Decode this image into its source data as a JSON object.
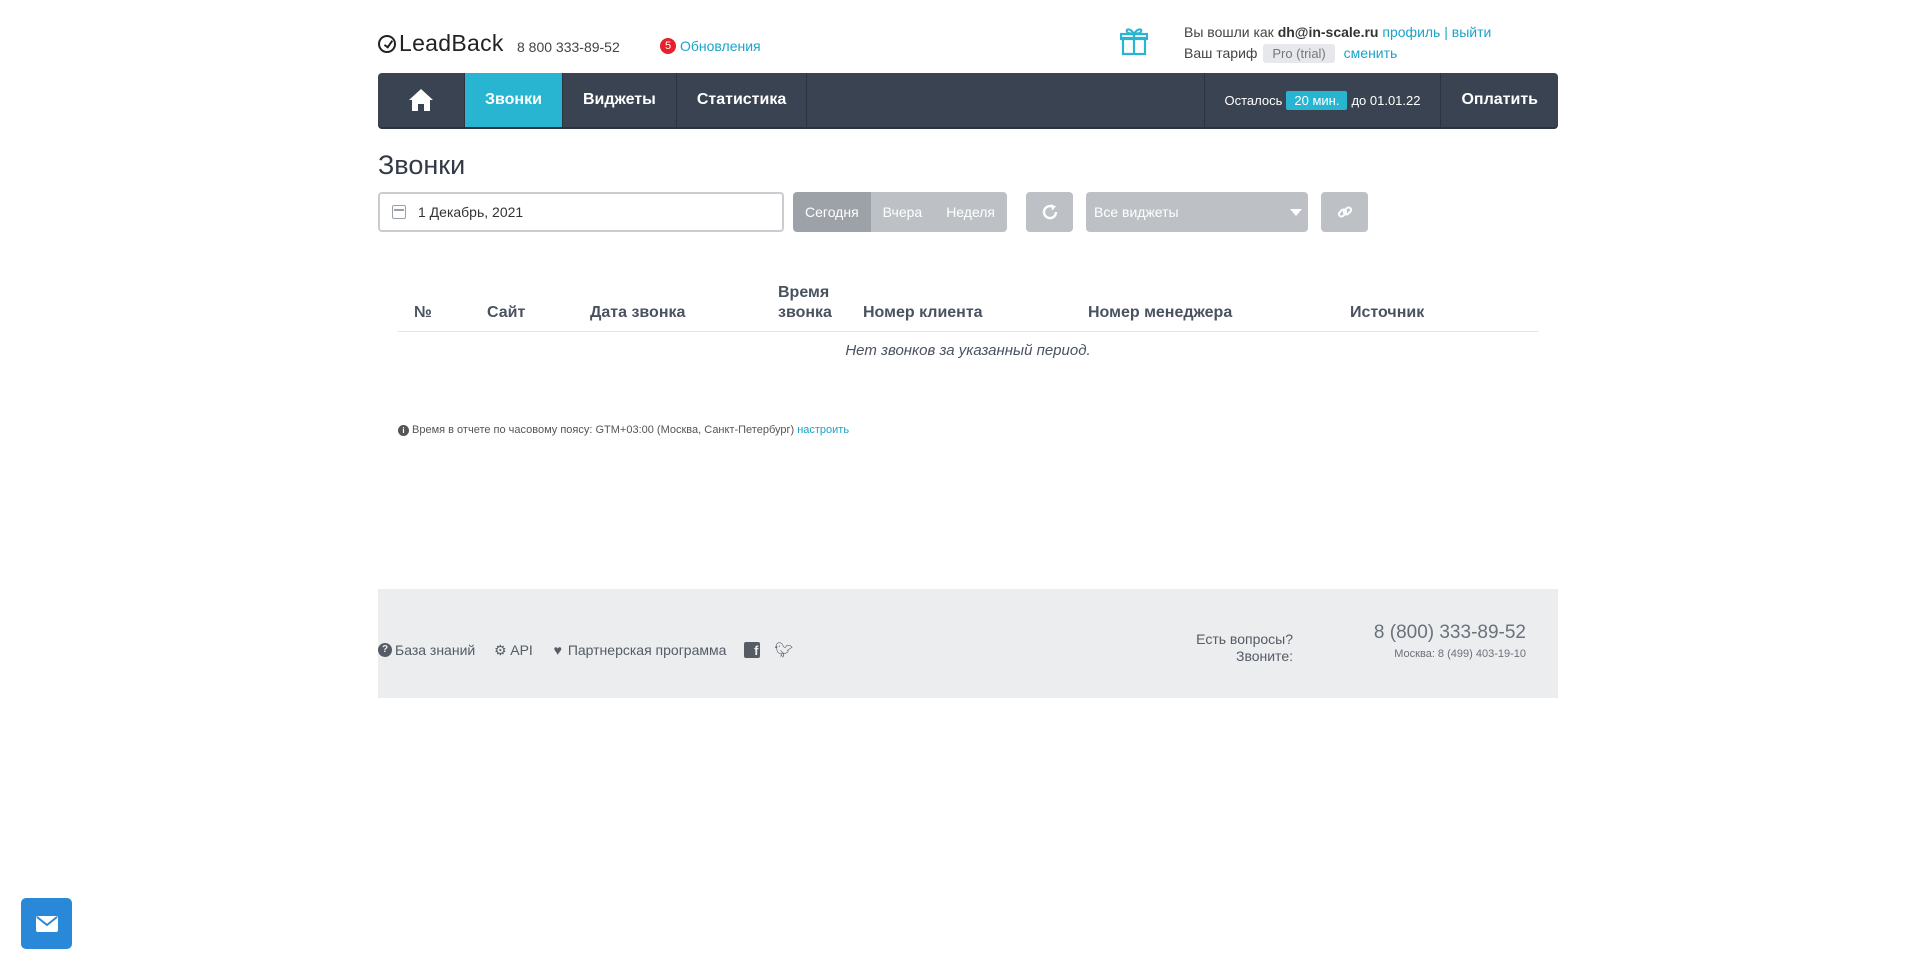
{
  "header": {
    "logo_text": "LeadBack",
    "phone": "8 800 333-89-52",
    "updates_count": "5",
    "updates_label": "Обновления",
    "logged_in_prefix": "Вы вошли как",
    "user_email": "dh@in-scale.ru",
    "profile_link": "профиль",
    "separator": "|",
    "logout_link": "выйти",
    "tariff_prefix": "Ваш тариф",
    "tariff_name": "Pro (trial)",
    "change_link": "сменить"
  },
  "navbar": {
    "items": [
      {
        "label": "Звонки",
        "active": true
      },
      {
        "label": "Виджеты",
        "active": false
      },
      {
        "label": "Статистика",
        "active": false
      }
    ],
    "remaining_prefix": "Осталось",
    "remaining_value": "20 мин.",
    "remaining_suffix": "до 01.01.22",
    "pay_label": "Оплатить"
  },
  "page": {
    "title": "Звонки",
    "date_value": "1 Декабрь, 2021",
    "range_buttons": [
      "Сегодня",
      "Вчера",
      "Неделя"
    ],
    "widgets_select": "Все виджеты"
  },
  "table": {
    "columns": [
      "№",
      "Сайт",
      "Дата звонка",
      "Время звонка",
      "Номер клиента",
      "Номер менеджера",
      "Источник"
    ],
    "empty_message": "Нет звонков за указанный период."
  },
  "timezone_note": {
    "text": "Время в отчете по часовому поясу: GTM+03:00 (Москва, Санкт-Петербург)",
    "link": "настроить"
  },
  "footer": {
    "links": [
      "База знаний",
      "API",
      "Партнерская программа"
    ],
    "questions_line1": "Есть вопросы?",
    "questions_line2": "Звоните:",
    "phone_main": "8 (800) 333-89-52",
    "phone_moscow": "Москва: 8 (499) 403-19-10"
  },
  "colors": {
    "accent": "#27b5d2",
    "navbar": "#3a4352",
    "link": "#1aa3c8",
    "mail_button": "#2a88d8"
  }
}
